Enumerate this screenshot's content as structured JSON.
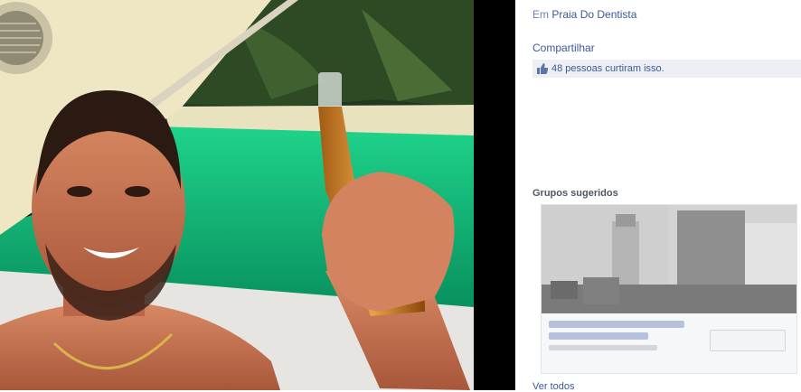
{
  "location": {
    "prefix": "Em",
    "name": "Praia Do Dentista"
  },
  "share_label": "Compartilhar",
  "likes": {
    "text": "48 pessoas curtiram isso."
  },
  "suggested_groups": {
    "title": "Grupos sugeridos",
    "card": {
      "title": "",
      "members": "",
      "join_label": ""
    }
  },
  "see_all_label": "Ver todos",
  "colors": {
    "link": "#3b5998",
    "likes_bg": "#edeff4",
    "water": "#0fa86c",
    "divider": "#000000"
  }
}
